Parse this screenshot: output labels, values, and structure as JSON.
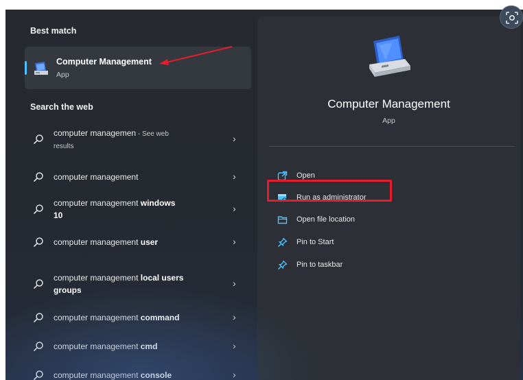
{
  "left": {
    "best_match_title": "Best match",
    "best_match": {
      "name": "Computer Management",
      "type": "App",
      "icon": "computer-management-icon"
    },
    "search_web_title": "Search the web",
    "web_items": [
      {
        "prefix": "computer managemen",
        "bold": "",
        "suffix": " - See web",
        "suffix2": "results"
      },
      {
        "prefix": "computer management",
        "bold": "",
        "suffix": "",
        "suffix2": ""
      },
      {
        "prefix": "computer management",
        "bold": " windows",
        "suffix": "",
        "suffix2": "10"
      },
      {
        "prefix": "computer management",
        "bold": " user",
        "suffix": "",
        "suffix2": ""
      },
      {
        "prefix": "computer management",
        "bold": " local users",
        "suffix": "",
        "suffix2": "groups"
      },
      {
        "prefix": "computer management",
        "bold": " command",
        "suffix": "",
        "suffix2": ""
      },
      {
        "prefix": "computer management",
        "bold": " cmd",
        "suffix": "",
        "suffix2": ""
      },
      {
        "prefix": "computer management",
        "bold": " console",
        "suffix": "",
        "suffix2": ""
      }
    ],
    "chevron": "›"
  },
  "right": {
    "app_name": "Computer Management",
    "app_type": "App",
    "actions": [
      {
        "label": "Open",
        "icon": "open-icon"
      },
      {
        "label": "Run as administrator",
        "icon": "run-as-admin-icon"
      },
      {
        "label": "Open file location",
        "icon": "folder-icon"
      },
      {
        "label": "Pin to Start",
        "icon": "pin-icon"
      },
      {
        "label": "Pin to taskbar",
        "icon": "pin-icon"
      }
    ]
  },
  "colors": {
    "accent": "#4cc2ff",
    "annotation_red": "#e81c2b",
    "panel": "#2c3036",
    "background": "#262a30"
  }
}
